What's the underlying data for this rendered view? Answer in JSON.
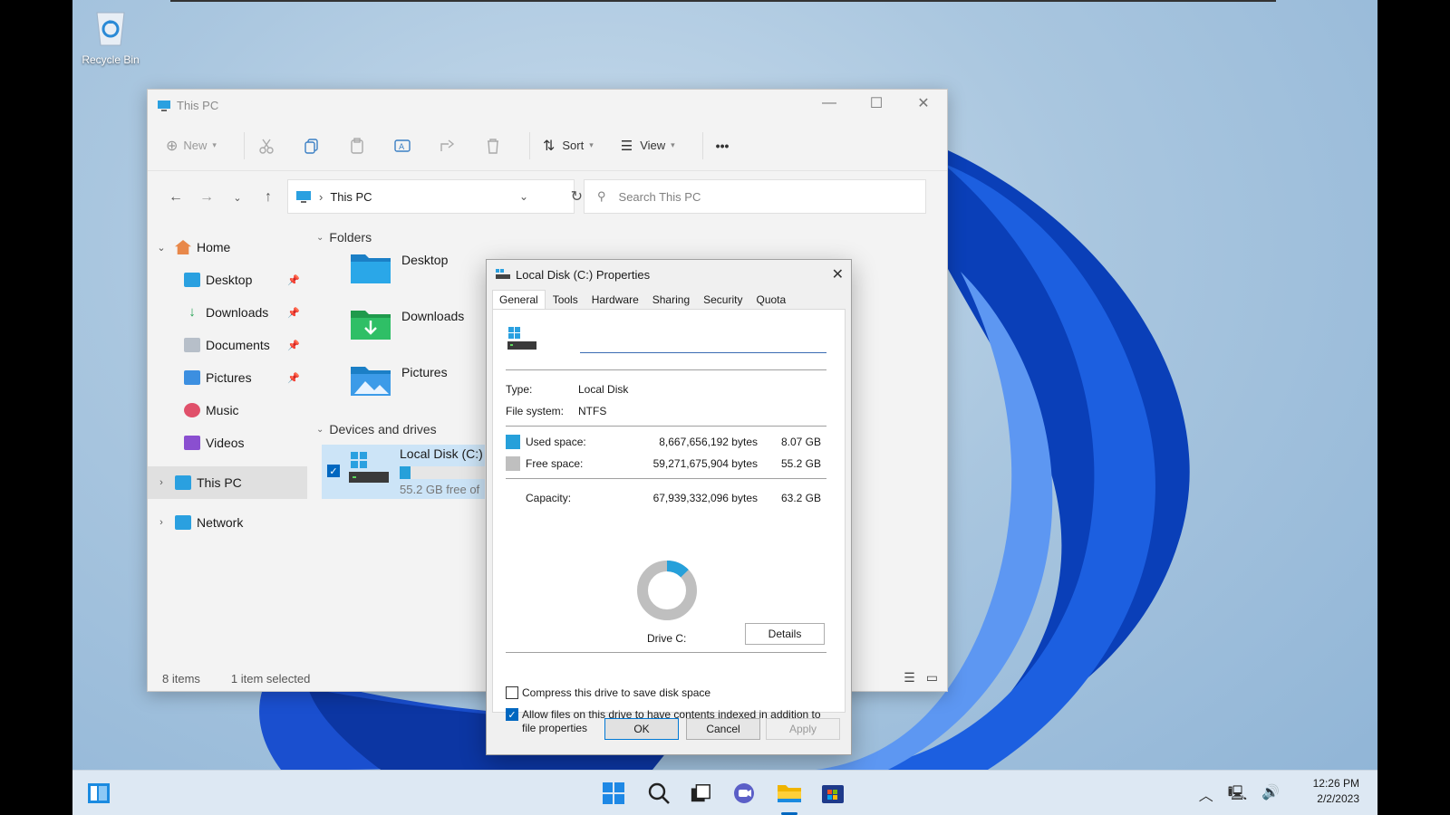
{
  "desktop": {
    "recycle_bin_label": "Recycle Bin"
  },
  "explorer": {
    "title": "This PC",
    "toolbar": {
      "new_label": "New",
      "sort_label": "Sort",
      "view_label": "View",
      "more_label": "•••"
    },
    "address": {
      "path": "This PC"
    },
    "search": {
      "placeholder": "Search This PC"
    },
    "sidebar": {
      "home": "Home",
      "items": [
        {
          "label": "Desktop",
          "pinned": true
        },
        {
          "label": "Downloads",
          "pinned": true
        },
        {
          "label": "Documents",
          "pinned": true
        },
        {
          "label": "Pictures",
          "pinned": true
        },
        {
          "label": "Music",
          "pinned": false
        },
        {
          "label": "Videos",
          "pinned": false
        }
      ],
      "this_pc": "This PC",
      "network": "Network"
    },
    "folders_header": "Folders",
    "folders": [
      "Desktop",
      "Downloads",
      "Pictures"
    ],
    "devices_header": "Devices and drives",
    "drive": {
      "name": "Local Disk (C:)",
      "free_text": "55.2 GB free of",
      "used_fraction": 0.13
    },
    "status": {
      "items": "8 items",
      "selected": "1 item selected"
    }
  },
  "dialog": {
    "title": "Local Disk (C:) Properties",
    "tabs": [
      "General",
      "Tools",
      "Hardware",
      "Sharing",
      "Security",
      "Quota"
    ],
    "active_tab": "General",
    "name_value": "",
    "type_label": "Type:",
    "type_value": "Local Disk",
    "fs_label": "File system:",
    "fs_value": "NTFS",
    "used_label": "Used space:",
    "used_bytes": "8,667,656,192 bytes",
    "used_gb": "8.07 GB",
    "free_label": "Free space:",
    "free_bytes": "59,271,675,904 bytes",
    "free_gb": "55.2 GB",
    "capacity_label": "Capacity:",
    "capacity_bytes": "67,939,332,096 bytes",
    "capacity_gb": "63.2 GB",
    "used_fraction": 0.128,
    "drive_label": "Drive C:",
    "details_button": "Details",
    "compress_label": "Compress this drive to save disk space",
    "compress_checked": false,
    "index_label": "Allow files on this drive to have contents indexed in addition to file properties",
    "index_checked": true,
    "ok": "OK",
    "cancel": "Cancel",
    "apply": "Apply",
    "colors": {
      "used": "#26a0da",
      "free": "#bfbfbf"
    }
  },
  "taskbar": {
    "time": "12:26 PM",
    "date": "2/2/2023",
    "icons": [
      "widgets-icon",
      "start-icon",
      "search-icon",
      "task-view-icon",
      "chat-icon",
      "file-explorer-icon",
      "store-icon"
    ]
  }
}
